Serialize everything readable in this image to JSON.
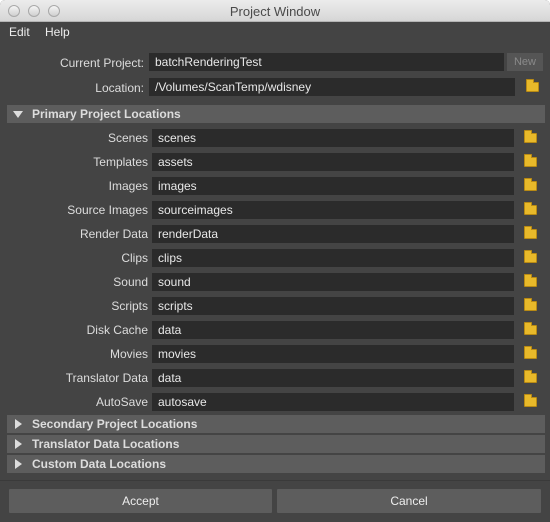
{
  "window": {
    "title": "Project Window"
  },
  "menu": [
    "Edit",
    "Help"
  ],
  "project": {
    "current_label": "Current Project:",
    "current_value": "batchRenderingTest",
    "new_label": "New",
    "location_label": "Location:",
    "location_value": "/Volumes/ScanTemp/wdisney"
  },
  "sections": {
    "primary": "Primary Project Locations",
    "secondary": "Secondary Project Locations",
    "translator": "Translator Data Locations",
    "custom": "Custom Data Locations"
  },
  "locations": [
    {
      "label": "Scenes",
      "value": "scenes"
    },
    {
      "label": "Templates",
      "value": "assets"
    },
    {
      "label": "Images",
      "value": "images"
    },
    {
      "label": "Source Images",
      "value": "sourceimages"
    },
    {
      "label": "Render Data",
      "value": "renderData"
    },
    {
      "label": "Clips",
      "value": "clips"
    },
    {
      "label": "Sound",
      "value": "sound"
    },
    {
      "label": "Scripts",
      "value": "scripts"
    },
    {
      "label": "Disk Cache",
      "value": "data"
    },
    {
      "label": "Movies",
      "value": "movies"
    },
    {
      "label": "Translator Data",
      "value": "data"
    },
    {
      "label": "AutoSave",
      "value": "autosave"
    }
  ],
  "buttons": {
    "accept": "Accept",
    "cancel": "Cancel"
  }
}
